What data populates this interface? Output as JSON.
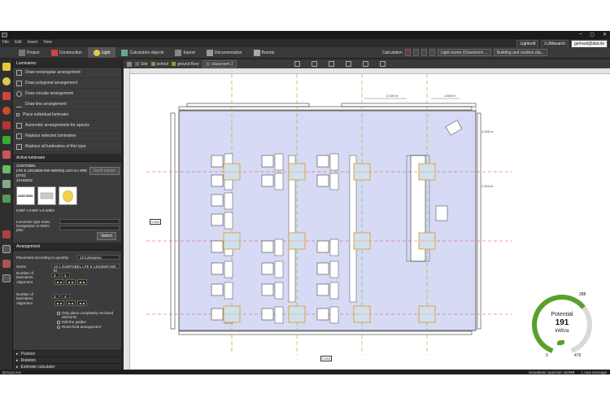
{
  "app": {
    "menu": [
      "File",
      "Edit",
      "Insert",
      "View"
    ],
    "window_controls": [
      "–",
      "▢",
      "✕"
    ],
    "account": {
      "lightsoft": "Lightsoft",
      "lumsearch": "LUMsearch",
      "user": "gerhard@dial.de"
    }
  },
  "ribbon": {
    "tabs": [
      {
        "label": "Project",
        "active": false
      },
      {
        "label": "Construction",
        "active": false
      },
      {
        "label": "Light",
        "active": true
      },
      {
        "label": "Calculation objects",
        "active": false
      },
      {
        "label": "Export",
        "active": false
      },
      {
        "label": "Documentation",
        "active": false
      },
      {
        "label": "Brands",
        "active": false
      }
    ],
    "calculation_label": "Calculation",
    "light_scene": "Light scene (Classroom ...",
    "building": "Building and outdoor pla..."
  },
  "viewbar": {
    "crumbs": [
      "Site",
      "school",
      "ground floor",
      "classroom 2"
    ]
  },
  "panel": {
    "header": "Luminaires",
    "items": [
      "Draw rectangular arrangement",
      "Draw polygonal arrangement",
      "Draw circular arrangement",
      "Draw line arrangement",
      "Place individual luminaire",
      "Automatic arrangements for spaces",
      "Replace selected luminaires",
      "Replace all luminaires of this type"
    ],
    "active_header": "Active luminaire",
    "lum_brand": "ZUMTOBEL",
    "lum_name": "LFE E LED3600-830 M60WQ LDO KA SRE",
    "lum_code": "[STD]",
    "lum_id": "42183532",
    "select_plastic": "Send plastic",
    "dimensions": "0.597 x 0.597 x 0.100m",
    "brand_logo": "ZUMTOBEL",
    "type_index_label": "Luminaire type index",
    "dwg_label": "Designation in DWG plan",
    "select_btn": "Select",
    "arrangement_header": "Arrangement",
    "placement_label": "Placement according to quantity",
    "placement_value": "12 luminaires",
    "name_label": "Name",
    "name_value": "12 x ZUMTOBEL LFE E LED3600-830 M",
    "num_label": "Number of luminaires",
    "num_x": "3",
    "num_y": "4",
    "align_label": "Alignment",
    "num_label2": "Number of luminaires",
    "num_x2": "2",
    "num_y2": "4",
    "align_label2": "Alignment",
    "opt1": "Only place completely enclosed elements",
    "opt2": "Edit the guides",
    "opt3": "Reset field arrangement",
    "sections": [
      "Position",
      "Rotation",
      "Estimate calculator"
    ]
  },
  "drawing": {
    "dim1": "2.100 m",
    "dim2": "1.800 m",
    "dim3": "3.200 m",
    "dim4": "2.404 m",
    "dim5": "0.650"
  },
  "gauge": {
    "title": "Potential",
    "value": "191",
    "unit": "kWh/a",
    "max_label": "288",
    "min_label": "0",
    "end_label": "479",
    "fill_fraction": 0.66,
    "color": "#5aa02c"
  },
  "status": {
    "left": "DIALux evo",
    "memory": "Verwalteter Speicher 162MB",
    "messages": "1 new message"
  }
}
